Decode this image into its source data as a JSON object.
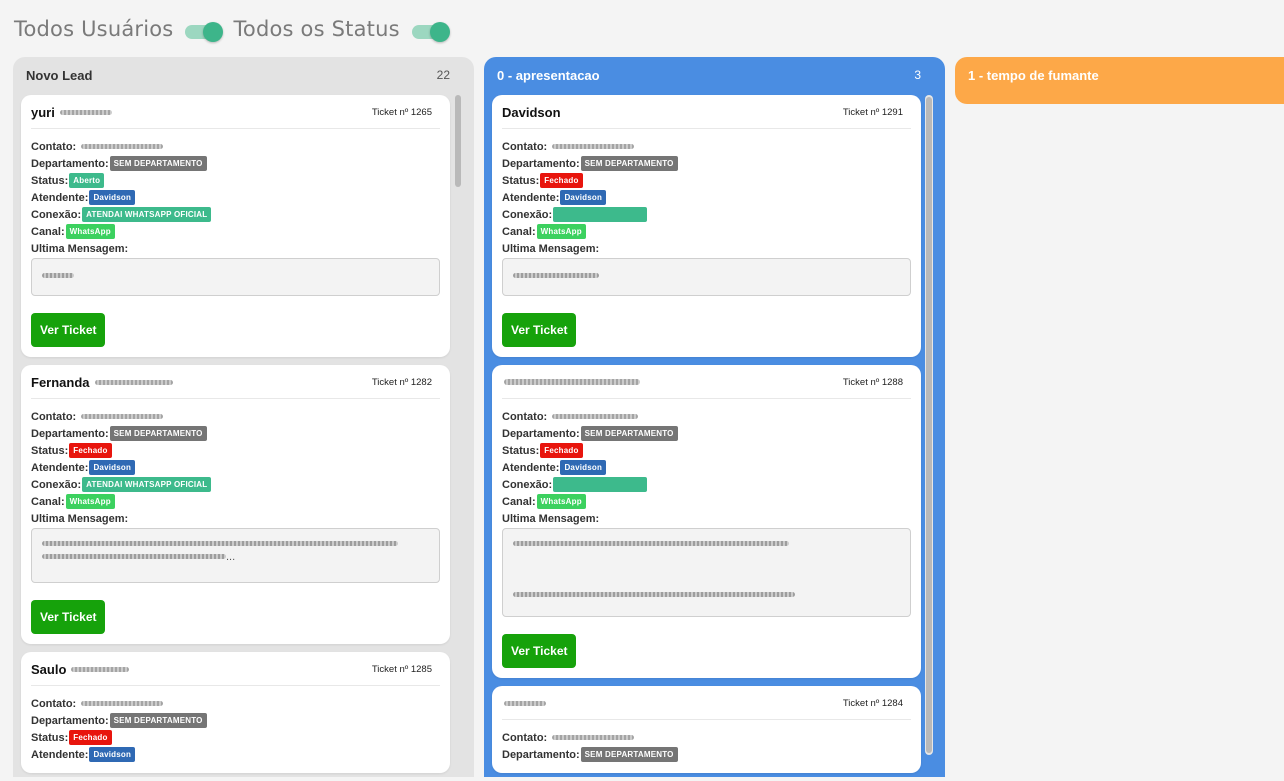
{
  "filters": {
    "users_label": "Todos Usuários",
    "status_label": "Todos os Status"
  },
  "labels": {
    "contato": "Contato:",
    "departamento": "Departamento:",
    "status": "Status:",
    "atendente": "Atendente:",
    "conexao": "Conexão:",
    "canal": "Canal:",
    "ultima": "Ultima Mensagem:",
    "ver_ticket": "Ver Ticket"
  },
  "colors": {
    "lane_default": "#e3e3e3",
    "lane_blue": "#4a8de2",
    "lane_orange": "#fda848",
    "status_open": "#3dba8c",
    "status_closed": "#e8150d",
    "agent": "#2f69b4",
    "whatsapp": "#3cd15f",
    "button": "#16a20b"
  },
  "lanes": [
    {
      "title": "Novo Lead",
      "count": "22",
      "cards": [
        {
          "name": "yuri",
          "ticket": "Ticket nº 1265",
          "departamento": "SEM DEPARTAMENTO",
          "status": "Aberto",
          "atendente": "Davidson",
          "conexao": "ATENDAI WHATSAPP OFICIAL",
          "canal": "WhatsApp",
          "ellipsis": ""
        },
        {
          "name": "Fernanda",
          "ticket": "Ticket nº 1282",
          "departamento": "SEM DEPARTAMENTO",
          "status": "Fechado",
          "atendente": "Davidson",
          "conexao": "ATENDAI WHATSAPP OFICIAL",
          "canal": "WhatsApp",
          "ellipsis": "..."
        },
        {
          "name": "Saulo",
          "ticket": "Ticket nº 1285",
          "departamento": "SEM DEPARTAMENTO",
          "status": "Fechado",
          "atendente": "Davidson"
        }
      ]
    },
    {
      "title": "0 - apresentacao",
      "count": "3",
      "cards": [
        {
          "name": "Davidson",
          "ticket": "Ticket nº 1291",
          "departamento": "SEM DEPARTAMENTO",
          "status": "Fechado",
          "atendente": "Davidson",
          "canal": "WhatsApp"
        },
        {
          "name": "",
          "ticket": "Ticket nº 1288",
          "departamento": "SEM DEPARTAMENTO",
          "status": "Fechado",
          "atendente": "Davidson",
          "canal": "WhatsApp"
        },
        {
          "name": "",
          "ticket": "Ticket nº 1284",
          "departamento": "SEM DEPARTAMENTO"
        }
      ]
    },
    {
      "title": "1 - tempo de fumante",
      "count": ""
    }
  ]
}
